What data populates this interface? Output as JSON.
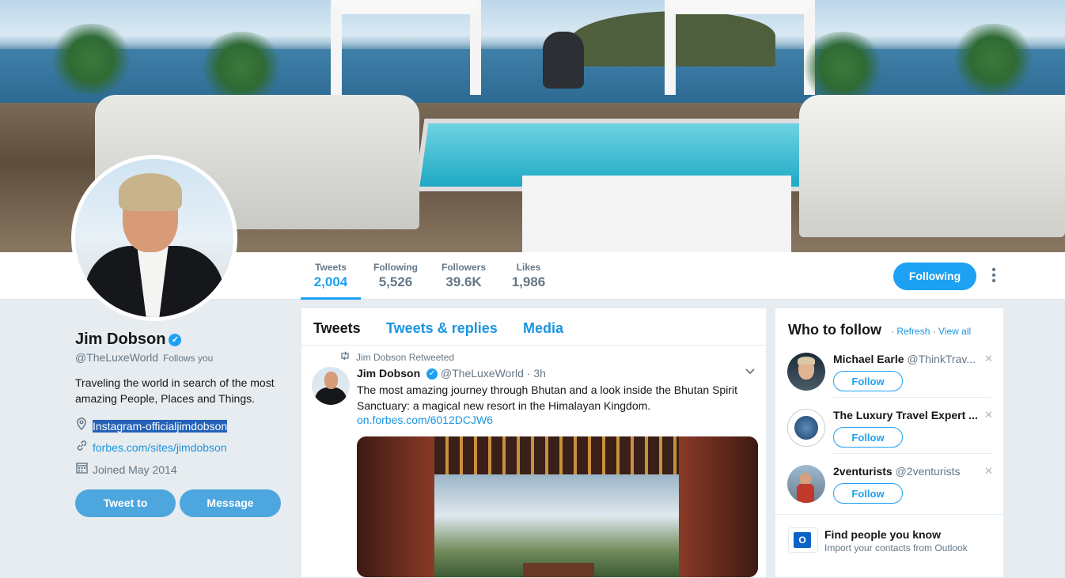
{
  "profile": {
    "name": "Jim Dobson",
    "handle": "@TheLuxeWorld",
    "follows_you": "Follows you",
    "bio": "Traveling the world in search of the most amazing People, Places and Things.",
    "location": "Instagram-officialjimdobson",
    "website": "forbes.com/sites/jimdobson",
    "joined": "Joined May 2014",
    "tweet_to_label": "Tweet to",
    "message_label": "Message"
  },
  "stats": [
    {
      "label": "Tweets",
      "value": "2,004"
    },
    {
      "label": "Following",
      "value": "5,526"
    },
    {
      "label": "Followers",
      "value": "39.6K"
    },
    {
      "label": "Likes",
      "value": "1,986"
    }
  ],
  "following_button": "Following",
  "timeline": {
    "tabs": [
      "Tweets",
      "Tweets & replies",
      "Media"
    ],
    "tweet": {
      "retweeted_by": "Jim Dobson Retweeted",
      "author": "Jim Dobson",
      "handle": "@TheLuxeWorld",
      "time": "· 3h",
      "text": "The most amazing journey through Bhutan and a look inside the Bhutan Spirit Sanctuary: a magical new resort in the Himalayan Kingdom.",
      "link": "on.forbes.com/6012DCJW6"
    }
  },
  "who_to_follow": {
    "title": "Who to follow",
    "refresh": "Refresh",
    "view_all": "View all",
    "suggestions": [
      {
        "name": "Michael Earle",
        "handle": "@ThinkTrav...",
        "follow_label": "Follow"
      },
      {
        "name": "The Luxury Travel Expert ...",
        "handle": "",
        "follow_label": "Follow"
      },
      {
        "name": "2venturists",
        "handle": "@2venturists",
        "follow_label": "Follow"
      }
    ],
    "find_people": {
      "title": "Find people you know",
      "subtitle": "Import your contacts from Outlook"
    }
  },
  "colors": {
    "accent": "#1da1f2",
    "link": "#1b95e0",
    "muted": "#657786",
    "background": "#e6ecf0"
  }
}
